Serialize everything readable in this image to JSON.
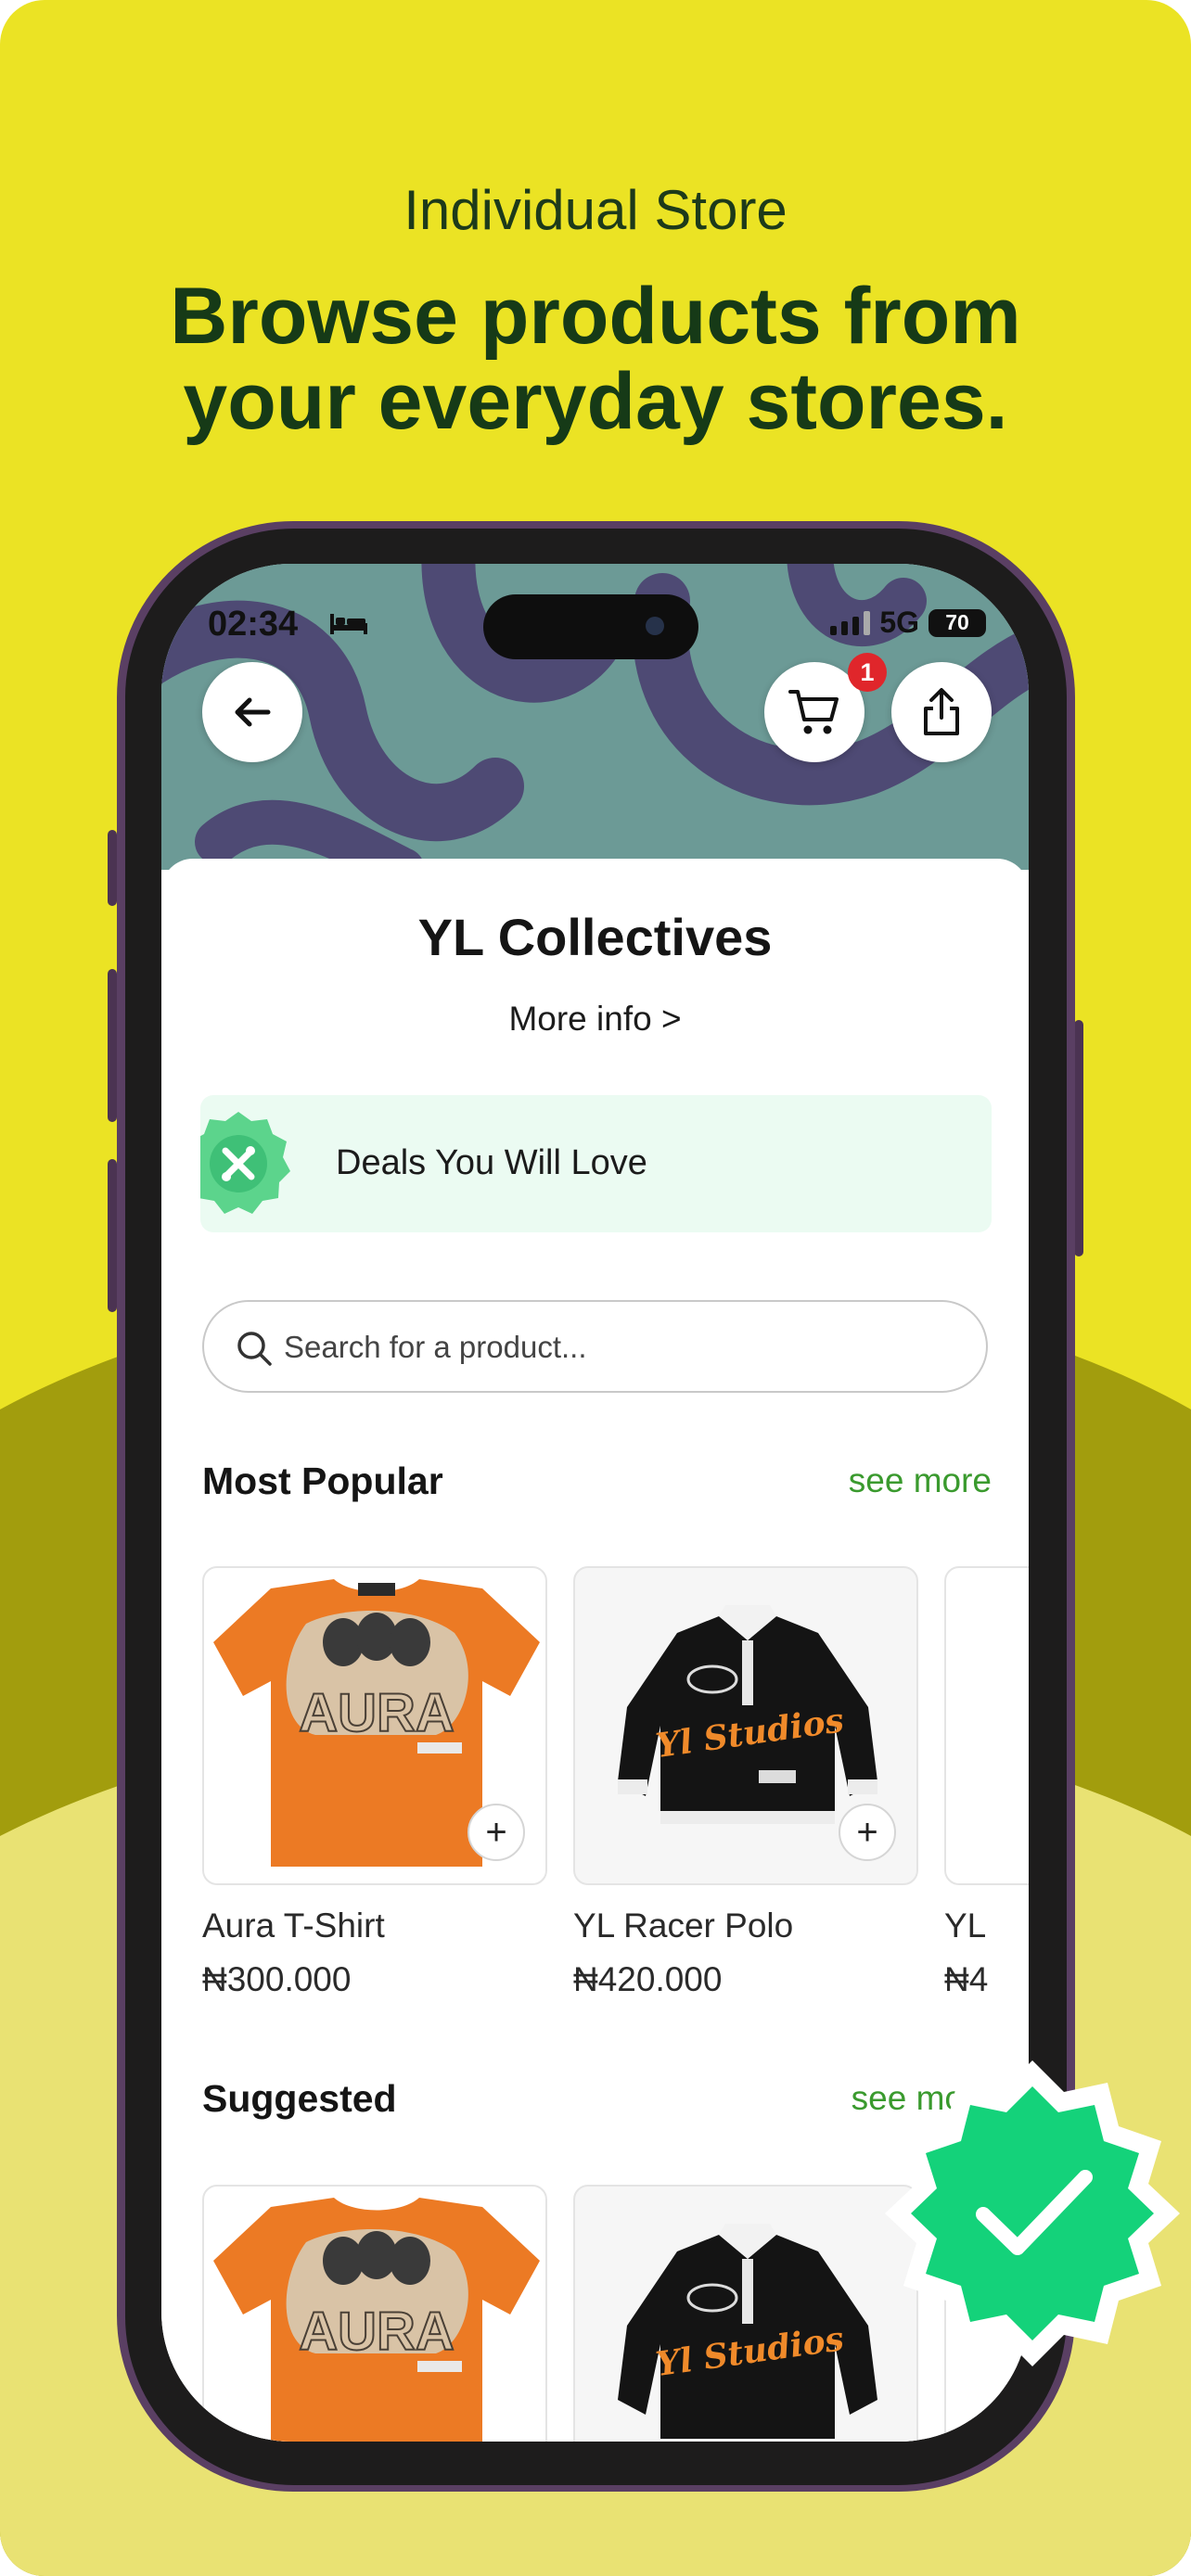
{
  "promo": {
    "subtitle": "Individual Store",
    "title_line1": "Browse products from",
    "title_line2": "your everyday stores."
  },
  "status_bar": {
    "time": "02:34",
    "network": "5G",
    "battery": "70"
  },
  "header": {
    "cart_badge": "1"
  },
  "store": {
    "name": "YL Collectives",
    "more_info": "More info >"
  },
  "deals_banner": {
    "label": "Deals You Will Love"
  },
  "search": {
    "placeholder": "Search for a product..."
  },
  "most_popular": {
    "title": "Most Popular",
    "see_more": "see more",
    "products": [
      {
        "name": "Aura T-Shirt",
        "price": "₦300.000"
      },
      {
        "name": "YL Racer Polo",
        "price": "₦420.000"
      },
      {
        "name": "YL",
        "price": "₦4"
      }
    ]
  },
  "suggested": {
    "title": "Suggested",
    "see_more": "see mo"
  },
  "colors": {
    "background": "#EBE324",
    "accent_green": "#3a9a2e",
    "badge_red": "#e0262b",
    "verified_green": "#14d27a"
  }
}
